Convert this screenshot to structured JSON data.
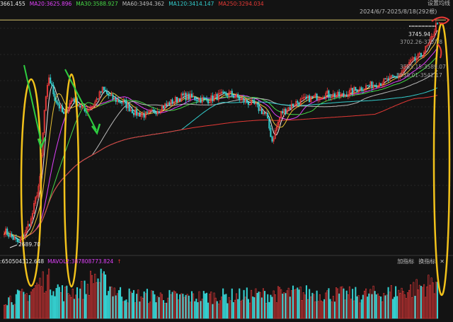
{
  "header": {
    "ma_items": [
      {
        "label": "3661.455",
        "color": "#e6e6e6"
      },
      {
        "label": "MA20:3625.896",
        "color": "#e040fb"
      },
      {
        "label": "MA30:3588.927",
        "color": "#46d846"
      },
      {
        "label": "MA60:3494.362",
        "color": "#bbbbbb"
      },
      {
        "label": "MA120:3414.147",
        "color": "#33cccc"
      },
      {
        "label": "MA250:3294.034",
        "color": "#e53935"
      }
    ],
    "settings": "设置均线",
    "range": "2024/6/7-2025/8/18(292根)"
  },
  "price_labels": {
    "high": "3745.94",
    "box1": "3702.26-3707.8",
    "box2": "3585.15-3589.07",
    "box3": "3538.01-3542.17",
    "low": "2689.70"
  },
  "volume_header": {
    "items": [
      {
        "label": ":650504312.648",
        "color": "#e6e6e6"
      },
      {
        "label": "MAVOL2:387808773.824",
        "color": "#e040fb"
      },
      {
        "label": "↑",
        "color": "#e53935"
      }
    ],
    "tools": [
      "加指标",
      "换指标",
      "✕"
    ]
  },
  "chart_data": {
    "type": "candlestick",
    "range": "2024/6/7-2025/8/18",
    "bar_count": 292,
    "ylim": [
      2660,
      3780
    ],
    "reference_line": 3745.94,
    "annotations": {
      "high": 3745.94,
      "low": 2689.7,
      "box_ranges": [
        [
          3702.26,
          3707.8
        ],
        [
          3585.15,
          3589.07
        ],
        [
          3538.01,
          3542.17
        ]
      ]
    },
    "moving_averages": [
      {
        "name": "MA20",
        "value": 3625.896,
        "color": "#e040fb"
      },
      {
        "name": "MA30",
        "value": 3588.927,
        "color": "#46d846"
      },
      {
        "name": "MA60",
        "value": 3494.362,
        "color": "#bbbbbb"
      },
      {
        "name": "MA120",
        "value": 3414.147,
        "color": "#33cccc"
      },
      {
        "name": "MA250",
        "value": 3294.034,
        "color": "#e53935"
      }
    ],
    "series_path": [
      [
        0,
        2760
      ],
      [
        10,
        2700
      ],
      [
        18,
        2810
      ],
      [
        24,
        3000
      ],
      [
        27,
        3320
      ],
      [
        30,
        3480
      ],
      [
        34,
        3380
      ],
      [
        40,
        3300
      ],
      [
        46,
        3380
      ],
      [
        54,
        3320
      ],
      [
        60,
        3350
      ],
      [
        66,
        3420
      ],
      [
        72,
        3380
      ],
      [
        80,
        3360
      ],
      [
        88,
        3310
      ],
      [
        96,
        3300
      ],
      [
        104,
        3330
      ],
      [
        112,
        3360
      ],
      [
        120,
        3390
      ],
      [
        128,
        3380
      ],
      [
        136,
        3370
      ],
      [
        144,
        3390
      ],
      [
        152,
        3400
      ],
      [
        160,
        3370
      ],
      [
        168,
        3350
      ],
      [
        176,
        3300
      ],
      [
        180,
        3180
      ],
      [
        186,
        3310
      ],
      [
        196,
        3360
      ],
      [
        206,
        3380
      ],
      [
        216,
        3400
      ],
      [
        226,
        3390
      ],
      [
        236,
        3420
      ],
      [
        246,
        3440
      ],
      [
        256,
        3460
      ],
      [
        264,
        3480
      ],
      [
        272,
        3540
      ],
      [
        280,
        3580
      ],
      [
        286,
        3640
      ],
      [
        291,
        3740
      ]
    ],
    "volume_scale": [
      0,
      1
    ],
    "volume_path": [
      [
        0,
        0.45
      ],
      [
        15,
        0.55
      ],
      [
        28,
        0.95
      ],
      [
        40,
        0.6
      ],
      [
        55,
        0.7
      ],
      [
        60,
        1.0
      ],
      [
        80,
        0.55
      ],
      [
        120,
        0.5
      ],
      [
        170,
        0.55
      ],
      [
        200,
        0.6
      ],
      [
        240,
        0.55
      ],
      [
        270,
        0.65
      ],
      [
        285,
        0.8
      ],
      [
        291,
        0.9
      ]
    ]
  }
}
